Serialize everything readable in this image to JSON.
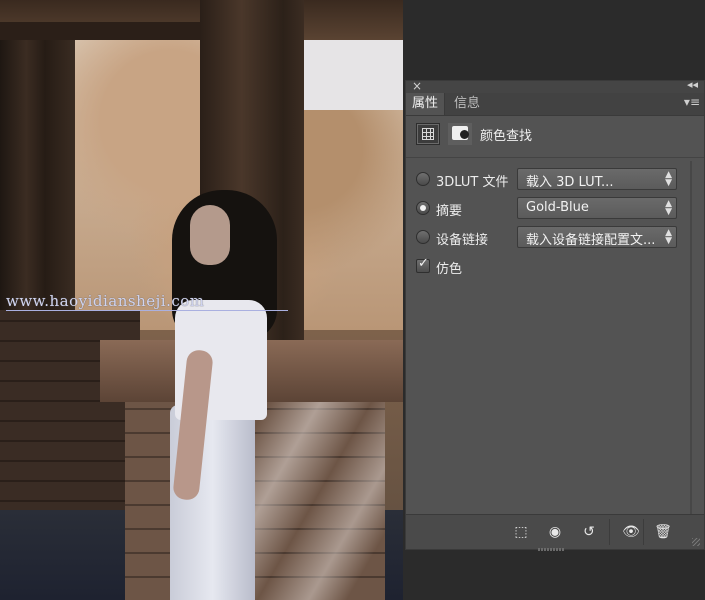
{
  "photo": {
    "watermark": "www.haoyidiansheji.com"
  },
  "panel": {
    "close_icon": "×",
    "collapse_icon": "◂◂",
    "menu_icon": "▾≡",
    "tabs": [
      {
        "label": "属性",
        "active": true
      },
      {
        "label": "信息",
        "active": false
      }
    ],
    "header": {
      "title": "颜色查找",
      "icons": [
        "grid-icon",
        "mask-icon"
      ]
    },
    "rows": [
      {
        "label": "3DLUT 文件",
        "type": "radio",
        "checked": false,
        "select": "载入 3D LUT..."
      },
      {
        "label": "摘要",
        "type": "radio",
        "checked": true,
        "select": "Gold-Blue"
      },
      {
        "label": "设备链接",
        "type": "radio",
        "checked": false,
        "select": "载入设备链接配置文..."
      }
    ],
    "dither": {
      "label": "仿色",
      "checked": true
    },
    "footer": {
      "buttons": [
        {
          "name": "clip-to-layer-icon",
          "glyph": "⬚"
        },
        {
          "name": "view-previous-icon",
          "glyph": "◉"
        },
        {
          "name": "reset-icon",
          "glyph": "↺"
        },
        {
          "name": "visibility-icon",
          "glyph": "👁"
        },
        {
          "name": "delete-icon",
          "glyph": "🗑"
        }
      ]
    }
  },
  "colors": {
    "panel_bg": "#535353",
    "tabbar_bg": "#424242",
    "text": "#e8e8e8"
  }
}
